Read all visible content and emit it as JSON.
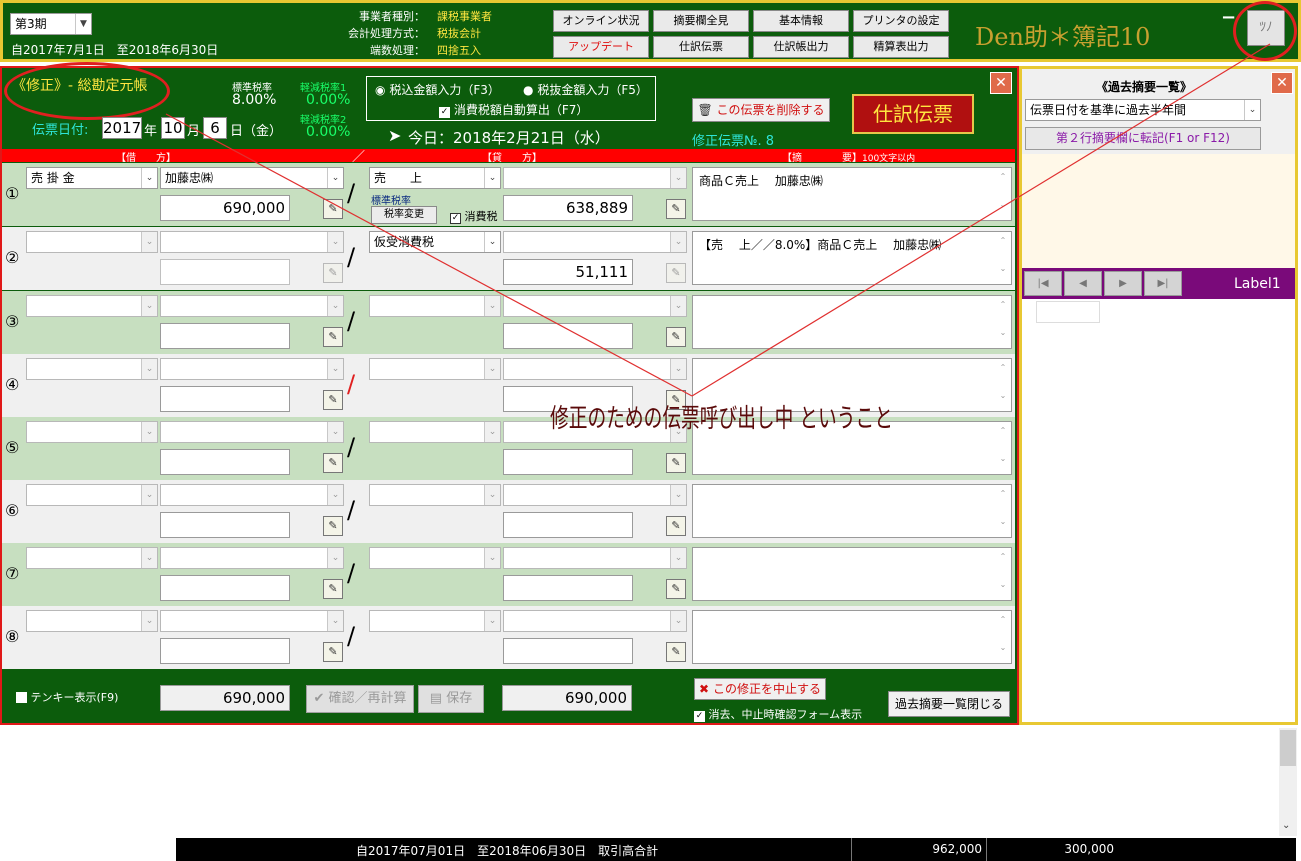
{
  "header": {
    "period": "第3期",
    "fiscal_range": "自2017年7月1日　至2018年6月30日",
    "biz_type_label": "事業者種別：",
    "biz_type_value": "課税事業者",
    "accounting_label": "会計処理方式：",
    "accounting_value": "税抜会計",
    "rounding_label": "端数処理：",
    "rounding_value": "四捨五入",
    "buttons": [
      "オンライン状況",
      "摘要欄全見",
      "基本情報",
      "プリンタの設定",
      "アップデート",
      "仕訳伝票",
      "仕訳帳出力",
      "精算表出力"
    ],
    "app_title": "Den助＊簿記10",
    "minimize": "−",
    "corner_icon": "ﾂﾉ"
  },
  "form": {
    "mode_title": "《修正》- 総勘定元帳",
    "std_rate_label": "標準税率",
    "std_rate_value": "8.00%",
    "reduced1_label": "軽減税率1",
    "reduced1_value": "0.00%",
    "reduced2_label": "軽減税率2",
    "reduced2_value": "0.00%",
    "radio_incl": "税込金額入力（F3）",
    "radio_excl": "税抜金額入力（F5）",
    "auto_tax": "消費税額自動算出（F7）",
    "delete_button": "この伝票を削除する",
    "voucher_badge": "仕訳伝票",
    "date_label": "伝票日付:",
    "year": "2017",
    "year_unit": "年",
    "month": "10",
    "month_unit": "月",
    "day": "6",
    "day_unit": "日（金）",
    "today": "今日：2018年2月21日（水）",
    "voucher_no": "修正伝票№. 8",
    "col_debit": "【借　　方】",
    "col_credit": "【貸　　方】",
    "col_memo_a": "【摘　　　　要】",
    "col_memo_b": "100文字以内"
  },
  "rows": [
    {
      "no": "①",
      "d_acc": "売 掛 金",
      "d_sub": "加藤忠㈱",
      "d_amt": "690,000",
      "c_acc": "売　　上",
      "c_sub": "",
      "c_amt": "638,889",
      "memo": "商品Ｃ売上　 加藤忠㈱"
    },
    {
      "no": "②",
      "d_acc": "",
      "d_sub": "",
      "d_amt": "",
      "c_acc": "仮受消費税",
      "c_sub": "",
      "c_amt": "51,111",
      "memo": "【売　 上／／8.0%】商品Ｃ売上　 加藤忠㈱"
    },
    {
      "no": "③",
      "d_acc": "",
      "d_sub": "",
      "d_amt": "",
      "c_acc": "",
      "c_sub": "",
      "c_amt": "",
      "memo": ""
    },
    {
      "no": "④",
      "d_acc": "",
      "d_sub": "",
      "d_amt": "",
      "c_acc": "",
      "c_sub": "",
      "c_amt": "",
      "memo": ""
    },
    {
      "no": "⑤",
      "d_acc": "",
      "d_sub": "",
      "d_amt": "",
      "c_acc": "",
      "c_sub": "",
      "c_amt": "",
      "memo": ""
    },
    {
      "no": "⑥",
      "d_acc": "",
      "d_sub": "",
      "d_amt": "",
      "c_acc": "",
      "c_sub": "",
      "c_amt": "",
      "memo": ""
    },
    {
      "no": "⑦",
      "d_acc": "",
      "d_sub": "",
      "d_amt": "",
      "c_acc": "",
      "c_sub": "",
      "c_amt": "",
      "memo": ""
    },
    {
      "no": "⑧",
      "d_acc": "",
      "d_sub": "",
      "d_amt": "",
      "c_acc": "",
      "c_sub": "",
      "c_amt": "",
      "memo": ""
    }
  ],
  "row1_extra": {
    "rate_label": "標準税率",
    "rate_change": "税率変更",
    "tax_check": "消費税"
  },
  "footer": {
    "tenkey": "テンキー表示(F9)",
    "debit_total": "690,000",
    "confirm": "確認／再計算",
    "save": "保存",
    "credit_total": "690,000",
    "cancel": "この修正を中止する",
    "confirm_form": "消去、中止時確認フォーム表示",
    "close_past": "過去摘要一覧閉じる"
  },
  "right_panel": {
    "title": "《過去摘要一覧》",
    "filter": "伝票日付を基準に過去半年間",
    "transfer": "第２行摘要欄に転記(F1 or F12)",
    "label": "Label1",
    "nav": [
      "|◀",
      "◀",
      "▶",
      "▶|"
    ]
  },
  "annotation": "修正のための伝票呼び出し中 ということ",
  "bottom": {
    "range": "自2017年07月01日　至2018年06月30日　取引高合計",
    "total1": "962,000",
    "total2": "300,000"
  }
}
